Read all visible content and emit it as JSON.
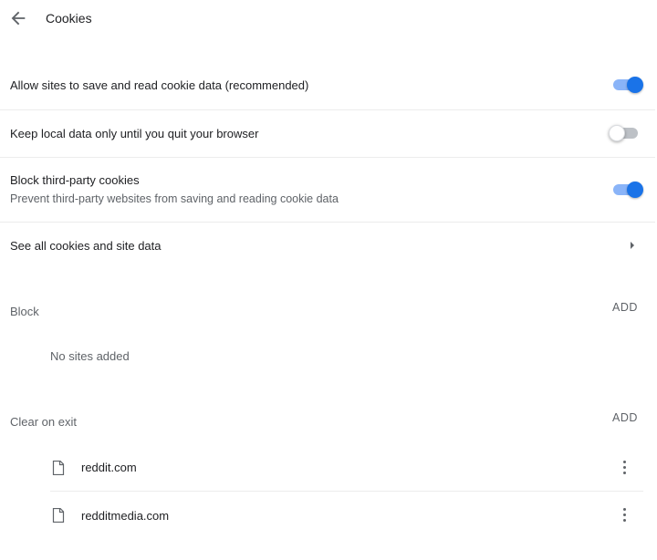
{
  "header": {
    "title": "Cookies",
    "back_icon": "arrow-back-icon"
  },
  "settings": {
    "allow_sites": {
      "label": "Allow sites to save and read cookie data (recommended)",
      "enabled": true
    },
    "keep_local": {
      "label": "Keep local data only until you quit your browser",
      "enabled": false
    },
    "block_third_party": {
      "label": "Block third-party cookies",
      "sublabel": "Prevent third-party websites from saving and reading cookie data",
      "enabled": true
    },
    "see_all": {
      "label": "See all cookies and site data",
      "icon": "arrow-right-icon"
    }
  },
  "block_section": {
    "title": "Block",
    "add_label": "ADD",
    "empty_text": "No sites added"
  },
  "clear_on_exit_section": {
    "title": "Clear on exit",
    "add_label": "ADD",
    "sites": [
      "reddit.com",
      "redditmedia.com"
    ]
  },
  "colors": {
    "accent": "#1a73e8",
    "accent_track": "#8ab4f8",
    "off_track": "#bdc1c6",
    "secondary_text": "#5f6368"
  }
}
